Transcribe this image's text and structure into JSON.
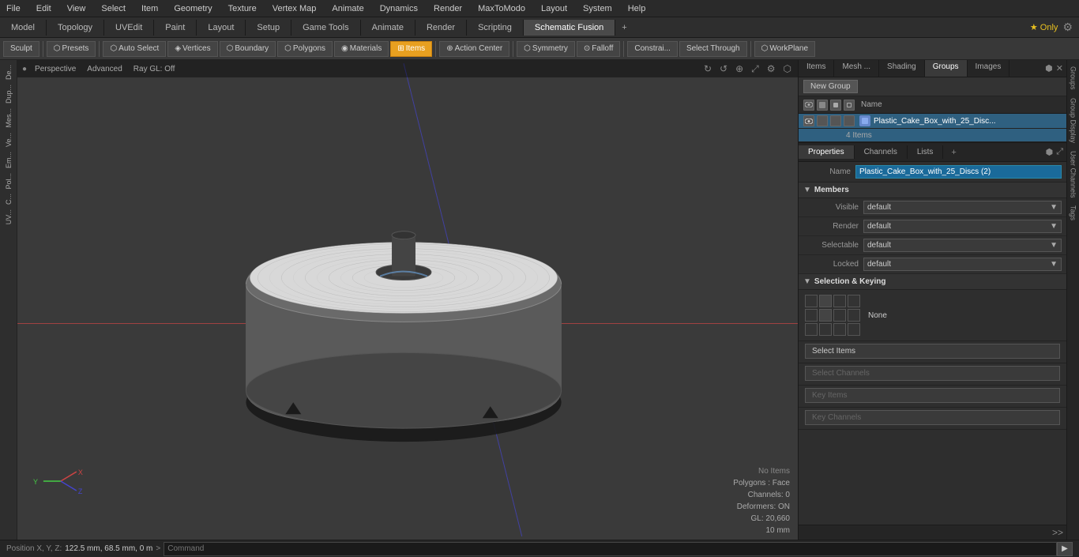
{
  "menubar": {
    "items": [
      "File",
      "Edit",
      "View",
      "Select",
      "Item",
      "Geometry",
      "Texture",
      "Vertex Map",
      "Animate",
      "Dynamics",
      "Render",
      "MaxToModo",
      "Layout",
      "System",
      "Help"
    ]
  },
  "mode_tabs": {
    "tabs": [
      "Model",
      "Topology",
      "UVEdit",
      "Paint",
      "Layout",
      "Setup",
      "Game Tools",
      "Animate",
      "Render",
      "Scripting",
      "Schematic Fusion"
    ],
    "active": "Schematic Fusion",
    "only_badge": "★ Only"
  },
  "toolbar": {
    "sculpt_label": "Sculpt",
    "presets_label": "Presets",
    "autoselect_label": "Auto Select",
    "vertices_label": "Vertices",
    "boundary_label": "Boundary",
    "polygons_label": "Polygons",
    "materials_label": "Materials",
    "items_label": "Items",
    "action_center_label": "Action Center",
    "symmetry_label": "Symmetry",
    "falloff_label": "Falloff",
    "constrain_label": "Constrai...",
    "select_through_label": "Select Through",
    "workplane_label": "WorkPlane"
  },
  "viewport": {
    "mode": "Perspective",
    "advanced": "Advanced",
    "ray_gl": "Ray GL: Off",
    "no_items": "No Items",
    "polygons": "Polygons : Face",
    "channels": "Channels: 0",
    "deformers": "Deformers: ON",
    "gl": "GL: 20,660",
    "size": "10 mm"
  },
  "right_panel": {
    "tabs": [
      "Items",
      "Mesh ...",
      "Shading",
      "Groups",
      "Images"
    ],
    "active_tab": "Groups",
    "new_group_btn": "New Group",
    "name_col": "Name",
    "group_name": "Plastic_Cake_Box_with_25_Disc...",
    "group_count": "4 Items",
    "props": {
      "tabs": [
        "Properties",
        "Channels",
        "Lists"
      ],
      "active": "Properties",
      "name_label": "Name",
      "name_value": "Plastic_Cake_Box_with_25_Discs (2)",
      "members_label": "Members",
      "visible_label": "Visible",
      "visible_value": "default",
      "render_label": "Render",
      "render_value": "default",
      "selectable_label": "Selectable",
      "selectable_value": "default",
      "locked_label": "Locked",
      "locked_value": "default",
      "sel_keying_label": "Selection & Keying",
      "keying_none_label": "None",
      "select_items_btn": "Select Items",
      "select_channels_btn": "Select Channels",
      "key_items_btn": "Key Items",
      "key_channels_btn": "Key Channels"
    }
  },
  "vtabs": {
    "labels": [
      "Groups",
      "Group Display",
      "User Channels",
      "Tags"
    ]
  },
  "bottom_bar": {
    "pos_label": "Position X, Y, Z:",
    "pos_value": "122.5 mm, 68.5 mm, 0 m",
    "cmd_prompt": ">",
    "cmd_placeholder": "Command"
  }
}
